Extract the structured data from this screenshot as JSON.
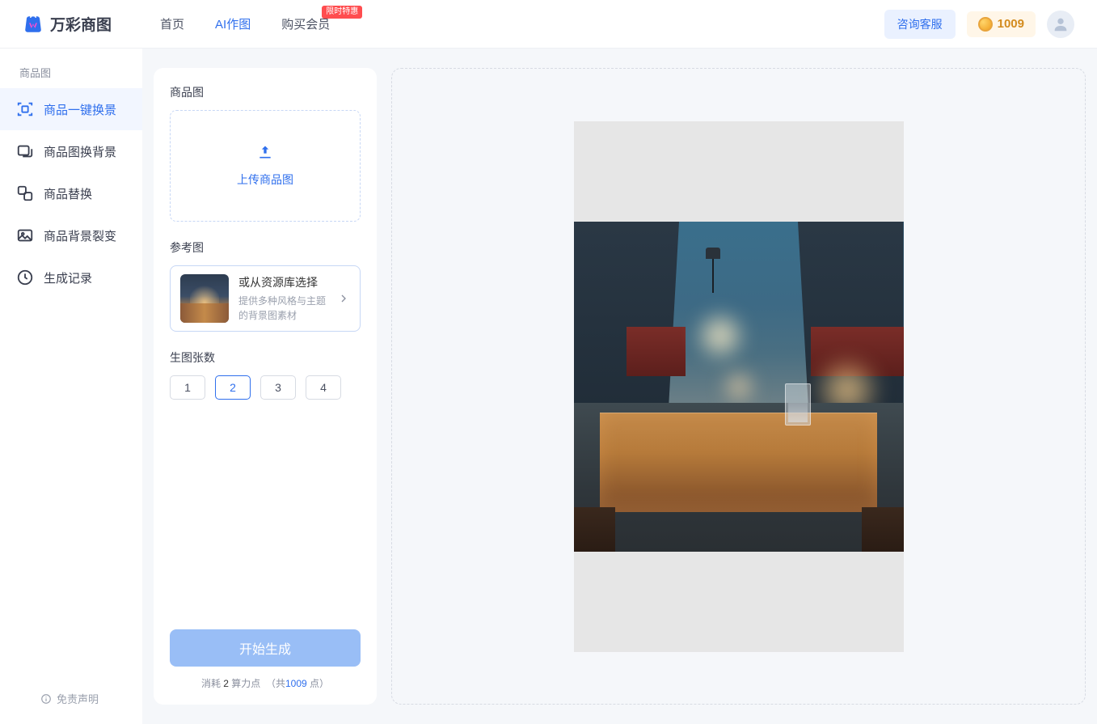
{
  "header": {
    "brand": "万彩商图",
    "nav": [
      {
        "label": "首页",
        "active": false,
        "badge": null
      },
      {
        "label": "AI作图",
        "active": true,
        "badge": null
      },
      {
        "label": "购买会员",
        "active": false,
        "badge": "限时特惠"
      }
    ],
    "contact": "咨询客服",
    "points": "1009"
  },
  "sidebar": {
    "group_label": "商品图",
    "items": [
      {
        "label": "商品一键换景",
        "icon": "scan",
        "active": true
      },
      {
        "label": "商品图换背景",
        "icon": "image-swap",
        "active": false
      },
      {
        "label": "商品替换",
        "icon": "replace",
        "active": false
      },
      {
        "label": "商品背景裂变",
        "icon": "gallery",
        "active": false
      },
      {
        "label": "生成记录",
        "icon": "history",
        "active": false
      }
    ],
    "disclaimer": "免责声明"
  },
  "panel": {
    "upload_title": "商品图",
    "upload_cta": "上传商品图",
    "ref_title": "参考图",
    "ref_option_title": "或从资源库选择",
    "ref_option_sub": "提供多种风格与主题的背景图素材",
    "count_title": "生图张数",
    "counts": [
      "1",
      "2",
      "3",
      "4"
    ],
    "count_selected": "2",
    "generate": "开始生成",
    "cost_prefix": "消耗 ",
    "cost_value": "2",
    "cost_unit": " 算力点",
    "cost_total_prefix": "（共",
    "cost_total": "1009",
    "cost_total_suffix": " 点）"
  }
}
